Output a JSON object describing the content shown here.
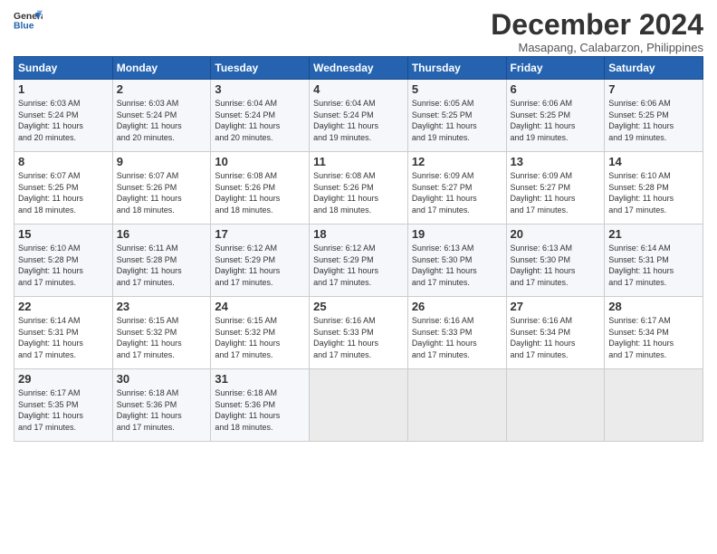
{
  "header": {
    "logo_line1": "General",
    "logo_line2": "Blue",
    "month": "December 2024",
    "location": "Masapang, Calabarzon, Philippines"
  },
  "weekdays": [
    "Sunday",
    "Monday",
    "Tuesday",
    "Wednesday",
    "Thursday",
    "Friday",
    "Saturday"
  ],
  "weeks": [
    [
      {
        "day": "1",
        "info": "Sunrise: 6:03 AM\nSunset: 5:24 PM\nDaylight: 11 hours\nand 20 minutes."
      },
      {
        "day": "2",
        "info": "Sunrise: 6:03 AM\nSunset: 5:24 PM\nDaylight: 11 hours\nand 20 minutes."
      },
      {
        "day": "3",
        "info": "Sunrise: 6:04 AM\nSunset: 5:24 PM\nDaylight: 11 hours\nand 20 minutes."
      },
      {
        "day": "4",
        "info": "Sunrise: 6:04 AM\nSunset: 5:24 PM\nDaylight: 11 hours\nand 19 minutes."
      },
      {
        "day": "5",
        "info": "Sunrise: 6:05 AM\nSunset: 5:25 PM\nDaylight: 11 hours\nand 19 minutes."
      },
      {
        "day": "6",
        "info": "Sunrise: 6:06 AM\nSunset: 5:25 PM\nDaylight: 11 hours\nand 19 minutes."
      },
      {
        "day": "7",
        "info": "Sunrise: 6:06 AM\nSunset: 5:25 PM\nDaylight: 11 hours\nand 19 minutes."
      }
    ],
    [
      {
        "day": "8",
        "info": "Sunrise: 6:07 AM\nSunset: 5:25 PM\nDaylight: 11 hours\nand 18 minutes."
      },
      {
        "day": "9",
        "info": "Sunrise: 6:07 AM\nSunset: 5:26 PM\nDaylight: 11 hours\nand 18 minutes."
      },
      {
        "day": "10",
        "info": "Sunrise: 6:08 AM\nSunset: 5:26 PM\nDaylight: 11 hours\nand 18 minutes."
      },
      {
        "day": "11",
        "info": "Sunrise: 6:08 AM\nSunset: 5:26 PM\nDaylight: 11 hours\nand 18 minutes."
      },
      {
        "day": "12",
        "info": "Sunrise: 6:09 AM\nSunset: 5:27 PM\nDaylight: 11 hours\nand 17 minutes."
      },
      {
        "day": "13",
        "info": "Sunrise: 6:09 AM\nSunset: 5:27 PM\nDaylight: 11 hours\nand 17 minutes."
      },
      {
        "day": "14",
        "info": "Sunrise: 6:10 AM\nSunset: 5:28 PM\nDaylight: 11 hours\nand 17 minutes."
      }
    ],
    [
      {
        "day": "15",
        "info": "Sunrise: 6:10 AM\nSunset: 5:28 PM\nDaylight: 11 hours\nand 17 minutes."
      },
      {
        "day": "16",
        "info": "Sunrise: 6:11 AM\nSunset: 5:28 PM\nDaylight: 11 hours\nand 17 minutes."
      },
      {
        "day": "17",
        "info": "Sunrise: 6:12 AM\nSunset: 5:29 PM\nDaylight: 11 hours\nand 17 minutes."
      },
      {
        "day": "18",
        "info": "Sunrise: 6:12 AM\nSunset: 5:29 PM\nDaylight: 11 hours\nand 17 minutes."
      },
      {
        "day": "19",
        "info": "Sunrise: 6:13 AM\nSunset: 5:30 PM\nDaylight: 11 hours\nand 17 minutes."
      },
      {
        "day": "20",
        "info": "Sunrise: 6:13 AM\nSunset: 5:30 PM\nDaylight: 11 hours\nand 17 minutes."
      },
      {
        "day": "21",
        "info": "Sunrise: 6:14 AM\nSunset: 5:31 PM\nDaylight: 11 hours\nand 17 minutes."
      }
    ],
    [
      {
        "day": "22",
        "info": "Sunrise: 6:14 AM\nSunset: 5:31 PM\nDaylight: 11 hours\nand 17 minutes."
      },
      {
        "day": "23",
        "info": "Sunrise: 6:15 AM\nSunset: 5:32 PM\nDaylight: 11 hours\nand 17 minutes."
      },
      {
        "day": "24",
        "info": "Sunrise: 6:15 AM\nSunset: 5:32 PM\nDaylight: 11 hours\nand 17 minutes."
      },
      {
        "day": "25",
        "info": "Sunrise: 6:16 AM\nSunset: 5:33 PM\nDaylight: 11 hours\nand 17 minutes."
      },
      {
        "day": "26",
        "info": "Sunrise: 6:16 AM\nSunset: 5:33 PM\nDaylight: 11 hours\nand 17 minutes."
      },
      {
        "day": "27",
        "info": "Sunrise: 6:16 AM\nSunset: 5:34 PM\nDaylight: 11 hours\nand 17 minutes."
      },
      {
        "day": "28",
        "info": "Sunrise: 6:17 AM\nSunset: 5:34 PM\nDaylight: 11 hours\nand 17 minutes."
      }
    ],
    [
      {
        "day": "29",
        "info": "Sunrise: 6:17 AM\nSunset: 5:35 PM\nDaylight: 11 hours\nand 17 minutes."
      },
      {
        "day": "30",
        "info": "Sunrise: 6:18 AM\nSunset: 5:36 PM\nDaylight: 11 hours\nand 17 minutes."
      },
      {
        "day": "31",
        "info": "Sunrise: 6:18 AM\nSunset: 5:36 PM\nDaylight: 11 hours\nand 18 minutes."
      },
      {
        "day": "",
        "info": ""
      },
      {
        "day": "",
        "info": ""
      },
      {
        "day": "",
        "info": ""
      },
      {
        "day": "",
        "info": ""
      }
    ]
  ]
}
